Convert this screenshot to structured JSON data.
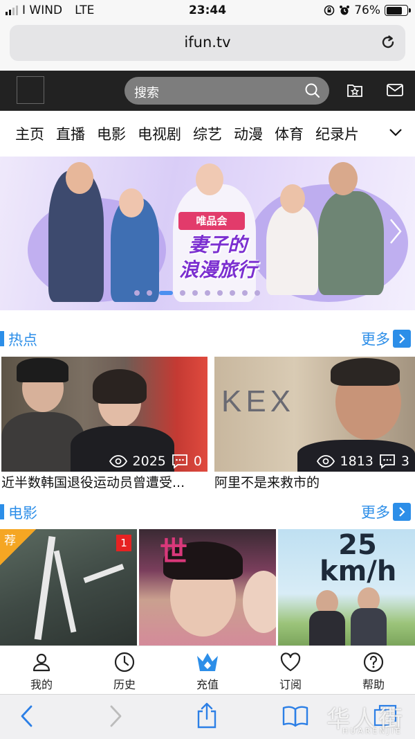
{
  "status_bar": {
    "carrier": "I WIND",
    "network": "LTE",
    "time": "23:44",
    "battery": "76%",
    "battery_level": 0.76
  },
  "browser": {
    "url": "ifun.tv"
  },
  "header": {
    "search_placeholder": "搜索",
    "icons": [
      "logo-placeholder",
      "search-icon",
      "favorites-icon",
      "mail-icon"
    ]
  },
  "categories": [
    "主页",
    "直播",
    "电影",
    "电视剧",
    "综艺",
    "动漫",
    "体育",
    "纪录片"
  ],
  "banner": {
    "logo_text": "唯品会",
    "title_line1": "妻子的",
    "title_line2": "浪漫旅行",
    "slide_count": 10,
    "active_slide": 2
  },
  "hot": {
    "title": "热点",
    "more": "更多",
    "cards": [
      {
        "title": "近半数韩国退役运动员曾遭受...",
        "views": "2025",
        "comments": "0"
      },
      {
        "title": "阿里不是来救市的",
        "views": "1813",
        "comments": "3"
      }
    ]
  },
  "movies": {
    "title": "电影",
    "more": "更多",
    "posters": [
      {
        "tag": "荐",
        "badge": "1"
      },
      {
        "tag": "",
        "badge": ""
      },
      {
        "tag": "",
        "badge": "",
        "poster_text": "25 km/h"
      }
    ]
  },
  "tabbar": {
    "items": [
      {
        "label": "我的",
        "icon": "user-icon"
      },
      {
        "label": "历史",
        "icon": "clock-icon"
      },
      {
        "label": "充值",
        "icon": "crown-icon"
      },
      {
        "label": "订阅",
        "icon": "heart-icon"
      },
      {
        "label": "帮助",
        "icon": "help-icon"
      }
    ]
  },
  "watermark": {
    "text": "华人街",
    "sub": "HUARENJIE"
  },
  "colors": {
    "accent": "#2c8ee8",
    "header_bg": "#222222",
    "badge_red": "#e62222",
    "tag_orange": "#f5a623"
  }
}
